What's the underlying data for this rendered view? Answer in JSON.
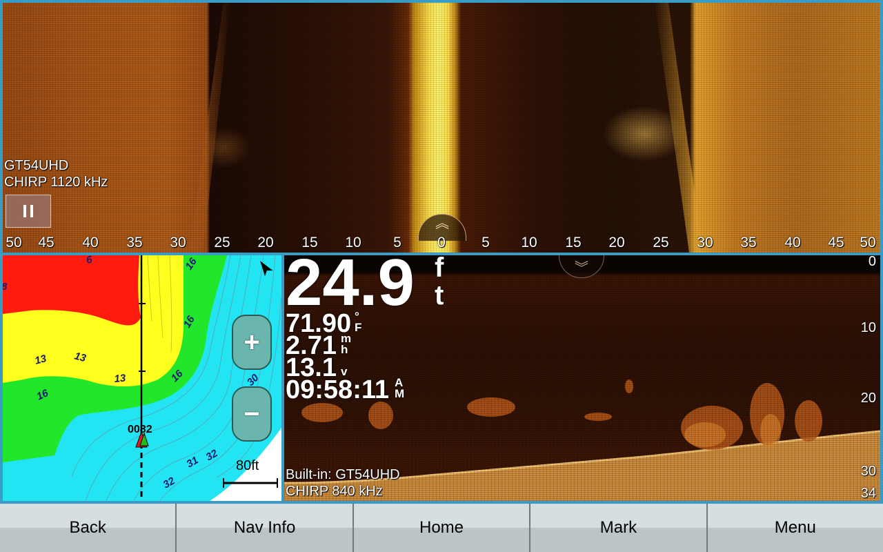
{
  "side_vu": {
    "transducer": "GT54UHD",
    "frequency": "CHIRP 1120 kHz",
    "pause_icon": "pause-icon",
    "up_icon": "double-chevron-up-icon",
    "range_scale": [
      "50",
      "45",
      "40",
      "35",
      "30",
      "25",
      "20",
      "15",
      "10",
      "5",
      "0",
      "5",
      "10",
      "15",
      "20",
      "25",
      "30",
      "35",
      "40",
      "45",
      "50"
    ]
  },
  "chart": {
    "zoom_in_label": "+",
    "zoom_out_label": "−",
    "scale_label": "80ft",
    "route_label": "0082",
    "north_icon": "north-arrow-icon",
    "depth_labels": [
      "6",
      "16",
      "16",
      "16",
      "13",
      "13",
      "13",
      "16",
      "30",
      "32",
      "31",
      "32",
      "32",
      "8"
    ]
  },
  "down_vu": {
    "depth": "24.9",
    "depth_unit_top": "f",
    "depth_unit_bottom": "t",
    "water_temp": "71.90",
    "temp_unit_top": "°",
    "temp_unit_bottom": "F",
    "speed": "2.71",
    "speed_unit_top": "m",
    "speed_unit_bottom": "h",
    "voltage": "13.1",
    "voltage_unit": "v",
    "time": "09:58:11",
    "time_unit_top": "A",
    "time_unit_bottom": "M",
    "transducer": "Built-in: GT54UHD",
    "frequency": "CHIRP 840 kHz",
    "down_icon": "double-chevron-down-icon",
    "depth_scale": [
      "0",
      "10",
      "20",
      "30",
      "34"
    ]
  },
  "buttons": {
    "back": "Back",
    "nav_info": "Nav Info",
    "home": "Home",
    "mark": "Mark",
    "menu": "Menu"
  },
  "colors": {
    "frame": "#3a9bc4",
    "chart_shallow_red": "#ff1a10",
    "chart_yellow": "#ffff1e",
    "chart_green": "#22e62a",
    "chart_cyan": "#23e4f2"
  }
}
